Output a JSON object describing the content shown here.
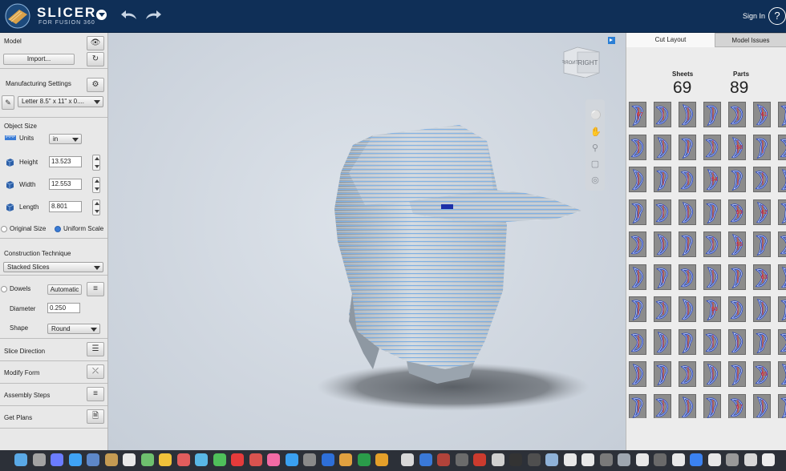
{
  "app": {
    "name": "SLICER",
    "subtitle": "FOR FUSION 360",
    "sign_in": "Sign In",
    "help": "?"
  },
  "left": {
    "model": {
      "heading": "Model",
      "import_label": "Import..."
    },
    "manufacturing": {
      "heading": "Manufacturing Settings",
      "sheet_value": "Letter 8.5\" x 11\" x 0...."
    },
    "object_size": {
      "heading": "Object Size",
      "units_label": "Units",
      "units_value": "in",
      "height_label": "Height",
      "height_value": "13.523",
      "width_label": "Width",
      "width_value": "12.553",
      "length_label": "Length",
      "length_value": "8.801",
      "original_size": "Original Size",
      "uniform_scale": "Uniform Scale"
    },
    "construction": {
      "heading": "Construction Technique",
      "value": "Stacked Slices"
    },
    "dowels": {
      "label": "Dowels",
      "mode": "Automatic",
      "diameter_label": "Diameter",
      "diameter_value": "0.250",
      "shape_label": "Shape",
      "shape_value": "Round"
    },
    "actions": [
      "Slice Direction",
      "Modify Form",
      "Assembly Steps",
      "Get Plans"
    ]
  },
  "viewport": {
    "viewcube_face": "RIGHT"
  },
  "right": {
    "tabs": [
      "Cut Layout",
      "Model Issues"
    ],
    "sheets_label": "Sheets",
    "sheets_value": "69",
    "parts_label": "Parts",
    "parts_value": "89",
    "part_labels": [
      [
        "67",
        "",
        "",
        "",
        "",
        "61",
        ""
      ],
      [
        "",
        "",
        "",
        "",
        "58",
        "",
        ""
      ],
      [
        "",
        "",
        "",
        "54",
        "",
        "",
        ""
      ],
      [
        "",
        "",
        "",
        "",
        "59",
        "62",
        ""
      ],
      [
        "",
        "",
        "",
        "",
        "55",
        "",
        ""
      ],
      [
        "",
        "",
        "",
        "",
        "",
        "63",
        ""
      ],
      [
        "",
        "",
        "",
        "56",
        "",
        "",
        ""
      ],
      [
        "",
        "",
        "",
        "",
        "",
        "",
        ""
      ],
      [
        "",
        "",
        "",
        "",
        "",
        "65",
        ""
      ],
      [
        "",
        "",
        "",
        "",
        "57",
        "",
        ""
      ]
    ]
  },
  "colors": {
    "topbar": "#0f2f57",
    "accent": "#2b7fd6",
    "slice_blue": "#6aa6e0",
    "part_outline": "#1f3fbf",
    "part_label": "#e8221f"
  }
}
